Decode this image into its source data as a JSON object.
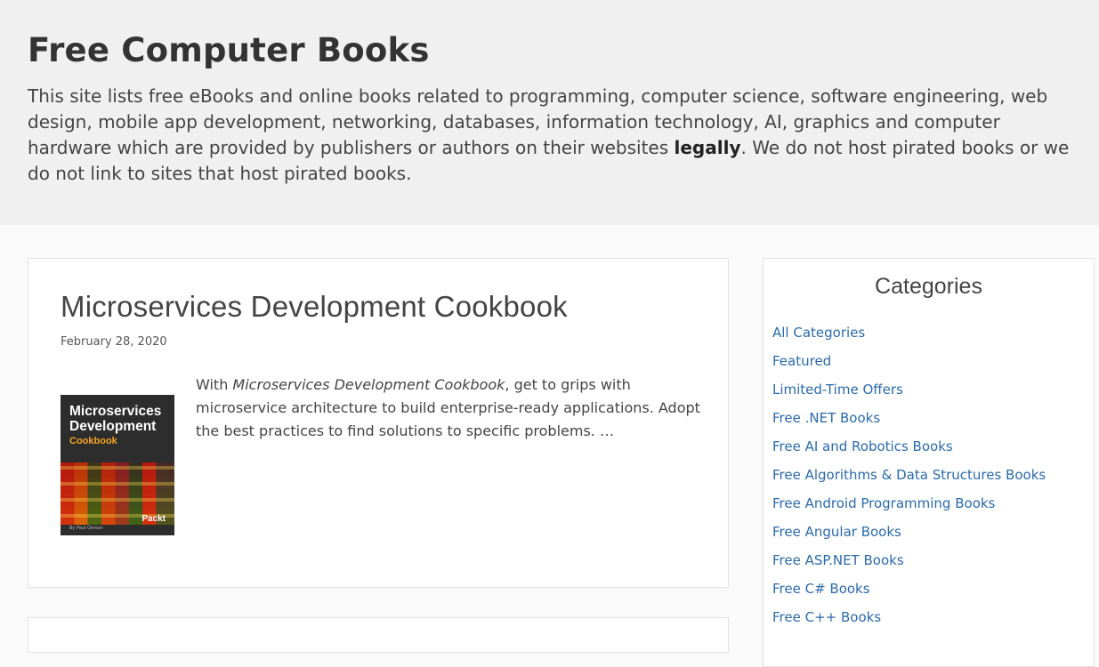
{
  "site": {
    "title": "Free Computer Books",
    "intro_before": "This site lists free eBooks and online books related to programming, computer science, software engineering, web design, mobile app development, networking, databases, information technology, AI, graphics and computer hardware which are provided by publishers or authors on their websites ",
    "intro_bold": "legally",
    "intro_after": ". We do not host pirated books or we do not link to sites that host pirated books."
  },
  "post": {
    "title": "Microservices Development Cookbook",
    "date": "February 28, 2020",
    "cover_title": "Microservices Development",
    "cover_subtitle": "Cookbook",
    "cover_brand": "Packt",
    "cover_author": "By Paul Osman",
    "excerpt_prefix": "With ",
    "excerpt_italic": "Microservices Development Cookbook",
    "excerpt_suffix": ", get to grips with microservice architecture to build enterprise-ready applications. Adopt the best practices to find solutions to specific problems. …"
  },
  "sidebar": {
    "heading": "Categories",
    "categories": [
      "All Categories",
      "Featured",
      "Limited-Time Offers",
      "Free .NET Books",
      "Free AI and Robotics Books",
      "Free Algorithms & Data Structures Books",
      "Free Android Programming Books",
      "Free Angular Books",
      "Free ASP.NET Books",
      "Free C# Books",
      "Free C++ Books"
    ]
  },
  "colors": {
    "link": "#2b6aa8",
    "hero_bg": "#f0f0f0",
    "page_bg": "#fafafa"
  }
}
